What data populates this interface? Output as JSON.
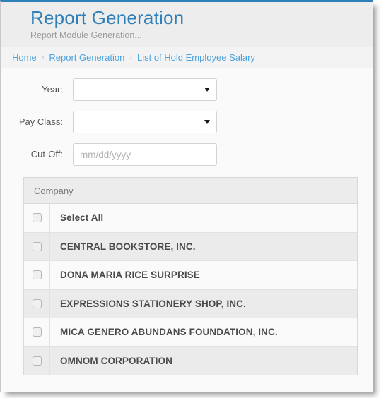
{
  "header": {
    "title": "Report Generation",
    "subtitle": "Report Module Generation...",
    "accent_color": "#2f7fb8"
  },
  "breadcrumb": {
    "separator": "›",
    "items": [
      {
        "label": "Home"
      },
      {
        "label": "Report Generation"
      },
      {
        "label": "List of Hold Employee Salary"
      }
    ]
  },
  "form": {
    "year": {
      "label": "Year:",
      "value": "",
      "icon": "chevron-down-icon"
    },
    "pay_class": {
      "label": "Pay Class:",
      "value": "",
      "icon": "chevron-down-icon"
    },
    "cut_off": {
      "label": "Cut-Off:",
      "value": "",
      "placeholder": "mm/dd/yyyy"
    }
  },
  "table": {
    "column_header": "Company",
    "rows": [
      {
        "name": "Select All",
        "checked": false
      },
      {
        "name": "CENTRAL BOOKSTORE, INC.",
        "checked": false
      },
      {
        "name": "DONA MARIA RICE SURPRISE",
        "checked": false
      },
      {
        "name": "EXPRESSIONS STATIONERY SHOP, INC.",
        "checked": false
      },
      {
        "name": "MICA GENERO ABUNDANS FOUNDATION, INC.",
        "checked": false
      },
      {
        "name": "OMNOM CORPORATION",
        "checked": false
      }
    ]
  }
}
